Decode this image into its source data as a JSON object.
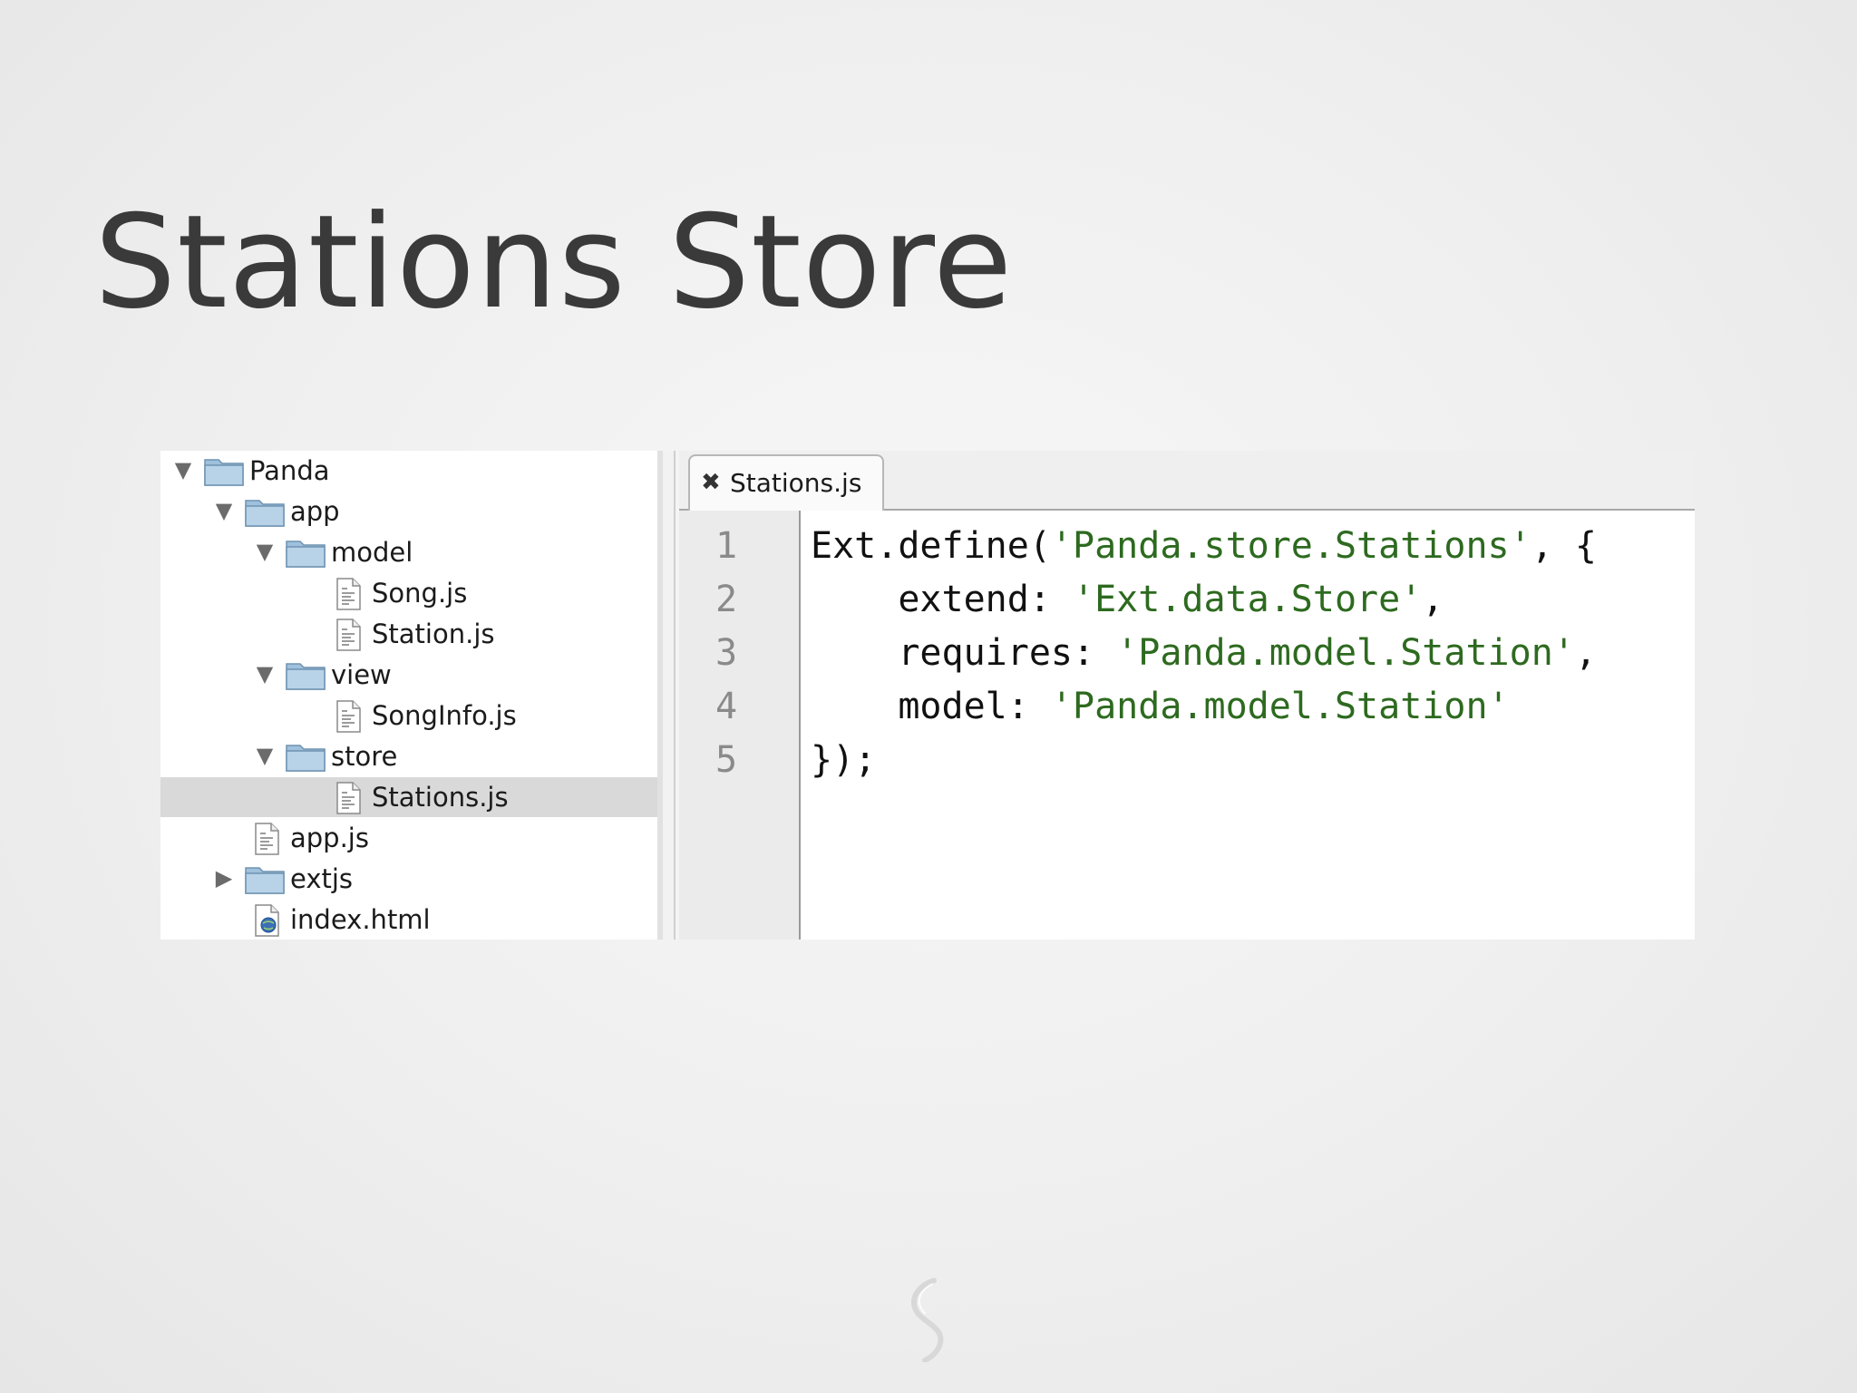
{
  "slide": {
    "title": "Stations Store"
  },
  "file_tree": [
    {
      "label": "Panda",
      "type": "folder",
      "expanded": true,
      "depth": 0,
      "icon": "folder-icon",
      "selected": false
    },
    {
      "label": "app",
      "type": "folder",
      "expanded": true,
      "depth": 1,
      "icon": "folder-icon",
      "selected": false
    },
    {
      "label": "model",
      "type": "folder",
      "expanded": true,
      "depth": 2,
      "icon": "folder-icon",
      "selected": false
    },
    {
      "label": "Song.js",
      "type": "file",
      "depth": 3,
      "icon": "js-file-icon",
      "selected": false
    },
    {
      "label": "Station.js",
      "type": "file",
      "depth": 3,
      "icon": "js-file-icon",
      "selected": false
    },
    {
      "label": "view",
      "type": "folder",
      "expanded": true,
      "depth": 2,
      "icon": "folder-icon",
      "selected": false
    },
    {
      "label": "SongInfo.js",
      "type": "file",
      "depth": 3,
      "icon": "js-file-icon",
      "selected": false
    },
    {
      "label": "store",
      "type": "folder",
      "expanded": true,
      "depth": 2,
      "icon": "folder-icon",
      "selected": false
    },
    {
      "label": "Stations.js",
      "type": "file",
      "depth": 3,
      "icon": "js-file-icon",
      "selected": true
    },
    {
      "label": "app.js",
      "type": "file",
      "depth": 1,
      "icon": "js-file-icon",
      "selected": false
    },
    {
      "label": "extjs",
      "type": "folder",
      "expanded": false,
      "depth": 1,
      "icon": "folder-icon",
      "selected": false
    },
    {
      "label": "index.html",
      "type": "file",
      "depth": 1,
      "icon": "html-file-icon",
      "selected": false
    }
  ],
  "editor": {
    "tab": {
      "label": "Stations.js",
      "close_glyph": "✖"
    },
    "lines": [
      {
        "number": "1",
        "tokens": [
          {
            "text": "Ext.define(",
            "kind": "plain"
          },
          {
            "text": "'Panda.store.Stations'",
            "kind": "string"
          },
          {
            "text": ", {",
            "kind": "plain"
          }
        ]
      },
      {
        "number": "2",
        "tokens": [
          {
            "text": "    extend: ",
            "kind": "plain"
          },
          {
            "text": "'Ext.data.Store'",
            "kind": "string"
          },
          {
            "text": ",",
            "kind": "plain"
          }
        ]
      },
      {
        "number": "3",
        "tokens": [
          {
            "text": "    requires: ",
            "kind": "plain"
          },
          {
            "text": "'Panda.model.Station'",
            "kind": "string"
          },
          {
            "text": ",",
            "kind": "plain"
          }
        ]
      },
      {
        "number": "4",
        "tokens": [
          {
            "text": "    model: ",
            "kind": "plain"
          },
          {
            "text": "'Panda.model.Station'",
            "kind": "string"
          }
        ]
      },
      {
        "number": "5",
        "tokens": [
          {
            "text": "});",
            "kind": "plain"
          }
        ]
      }
    ]
  },
  "colors": {
    "string": "#2d6a1f",
    "plain": "#111111",
    "line_number": "#8a8a8a",
    "selection": "#d9d9d9",
    "folder": "#8fb3cf"
  },
  "footer": {
    "logo_icon": "slideshare-s-icon"
  }
}
